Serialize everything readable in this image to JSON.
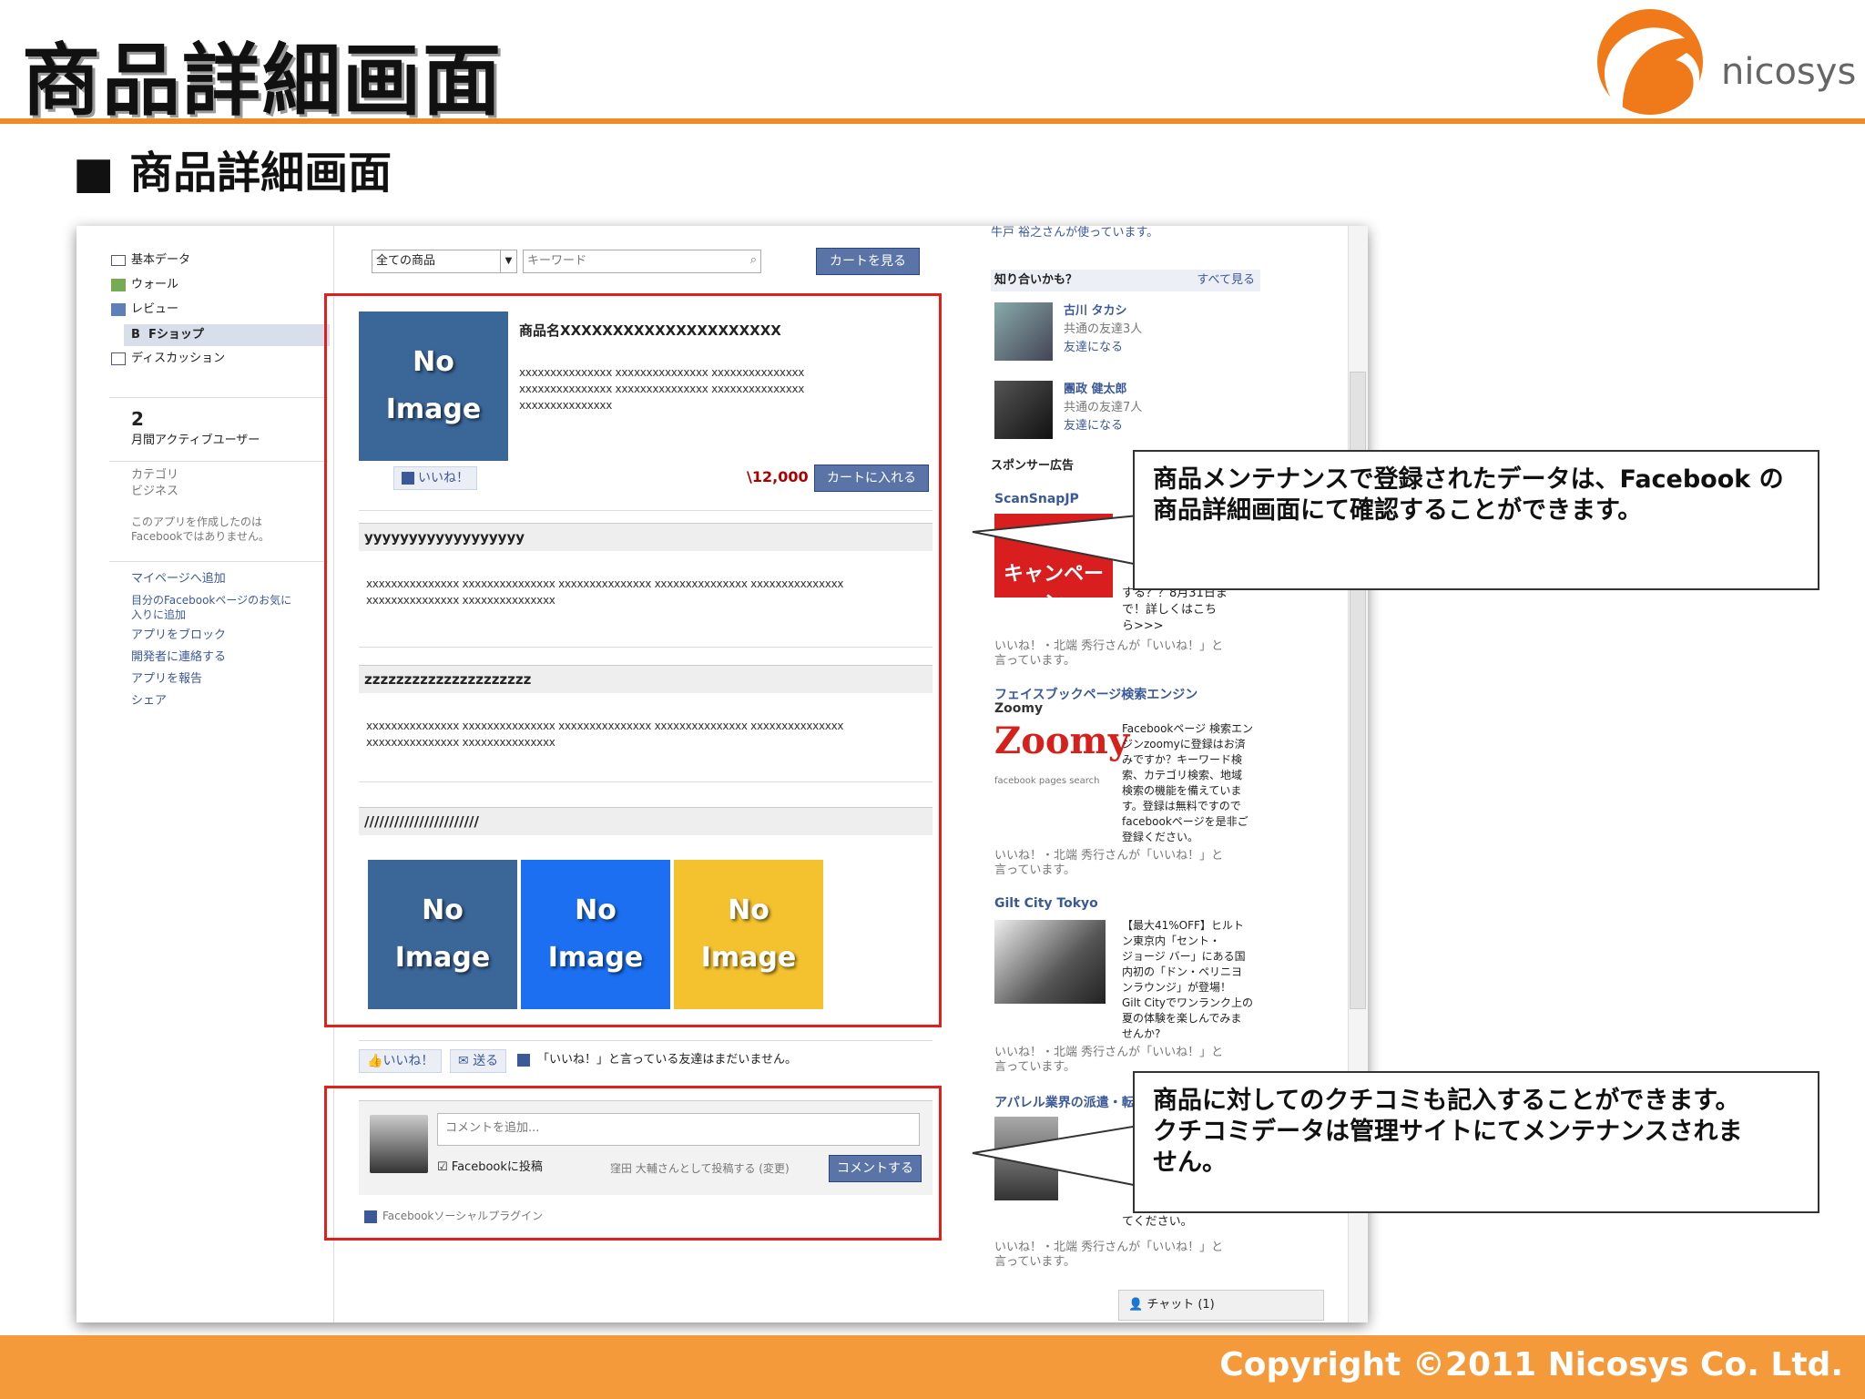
{
  "slide": {
    "title": "商品詳細画面",
    "section": "■ 商品詳細画面",
    "logo_text": "nicosys",
    "copyright": "Copyright ©2011 Nicosys Co. Ltd.",
    "accent": "#f08a24"
  },
  "left_nav": {
    "items": [
      {
        "label": "基本データ"
      },
      {
        "label": "ウォール"
      },
      {
        "label": "レビュー"
      },
      {
        "label": "Fショップ"
      },
      {
        "label": "ディスカッション"
      }
    ],
    "mau_count": "2",
    "mau_label": "月間アクティブユーザー",
    "category_label": "カテゴリ",
    "category_value": "ビジネス",
    "note_line1": "このアプリを作成したのは",
    "note_line2": "Facebookではありません。",
    "links": [
      "マイページへ追加",
      "目分のFacebookページのお気に",
      "入りに追加",
      "アプリをブロック",
      "開発者に連絡する",
      "アプリを報告",
      "シェア"
    ]
  },
  "search": {
    "category": "全ての商品",
    "placeholder": "キーワード",
    "view_cart": "カートを見る"
  },
  "product": {
    "no_image_line1": "No",
    "no_image_line2": "Image",
    "name": "商品名XXXXXXXXXXXXXXXXXXXXX",
    "desc_line1": "xxxxxxxxxxxxxxx xxxxxxxxxxxxxxx xxxxxxxxxxxxxxx",
    "desc_line2": "xxxxxxxxxxxxxxx xxxxxxxxxxxxxxx xxxxxxxxxxxxxxx",
    "desc_line3": "xxxxxxxxxxxxxxx",
    "like": "いいね！",
    "price": "\\12,000",
    "add_to_cart": "カートに入れる",
    "sec1_title": "yyyyyyyyyyyyyyyyyy",
    "sec2_title": "zzzzzzzzzzzzzzzzzzzzz",
    "sec3_title": "///////////////////////",
    "body_line1": "xxxxxxxxxxxxxxx xxxxxxxxxxxxxxx xxxxxxxxxxxxxxx xxxxxxxxxxxxxxx xxxxxxxxxxxxxxx",
    "body_line2": "xxxxxxxxxxxxxxx xxxxxxxxxxxxxxx",
    "thumb_colors": [
      "#3a6698",
      "#1b6ff0",
      "#f4c22e"
    ]
  },
  "social": {
    "like": "いいね！",
    "send": "送る",
    "no_likes": "「いいね！」と言っている友達はまだいません。"
  },
  "comment": {
    "placeholder": "コメントを追加...",
    "post_to_fb": "Facebookに投稿",
    "posting_as": "窪田 大輔さんとして投稿する (変更)",
    "submit": "コメントする",
    "plugin": "Facebookソーシャルプラグイン"
  },
  "right_col": {
    "using": "牛戸 裕之さんが使っています。",
    "pymk_title": "知り合いかも？",
    "see_all": "すべて見る",
    "people": [
      {
        "name": "古川 タカシ",
        "mutual": "共通の友達3人",
        "action": "友達になる"
      },
      {
        "name": "團政 健太郎",
        "mutual": "共通の友達7人",
        "action": "友達になる"
      }
    ],
    "sponsor": "スポンサー広告",
    "ad1_title": "ScanSnapJP",
    "ad1_banner": "キャンペーン",
    "ad1_text": [
      "する？？8月31日ま",
      "で！詳しくはこち",
      "ら>>>"
    ],
    "like_line1": "いいね！・北端 秀行さんが「いいね！」と",
    "like_line2": "言っています。",
    "ad2_title1": "フェイスブックページ検索エンジン",
    "ad2_title2": "Zoomy",
    "ad2_logo": "Zoomy",
    "ad2_logo_sub": "facebook pages search",
    "ad2_text": [
      "Facebookページ 検索エン",
      "ジンzoomyに登録はお済",
      "みですか？キーワード検",
      "索、カテゴリ検索、地域",
      "検索の機能を備えていま",
      "す。登録は無料ですので",
      "facebookページを是非ご",
      "登録ください。"
    ],
    "ad3_title": "Gilt City Tokyo",
    "ad3_text": [
      "【最大41%OFF】ヒルト",
      "ン東京内「セント・",
      "ジョージ バー」にある国",
      "内初の「ドン・ペリニヨ",
      "ンラウンジ」が登場！",
      "Gilt Cityでワンランク上の",
      "夏の体験を楽しんでみま",
      "せんか?"
    ],
    "ad4_title": "アパレル業界の派遣・転",
    "ad4_text": [
      "てください。"
    ],
    "chat": "チャット (1)"
  },
  "callouts": {
    "c1_line1": "商品メンテナンスで登録されたデータは、Facebook の",
    "c1_line2": "商品詳細画面にて確認することができます。",
    "c2_line1": "商品に対してのクチコミも記入することができます。",
    "c2_line2": "クチコミデータは管理サイトにてメンテナンスされま",
    "c2_line3": "せん。"
  }
}
